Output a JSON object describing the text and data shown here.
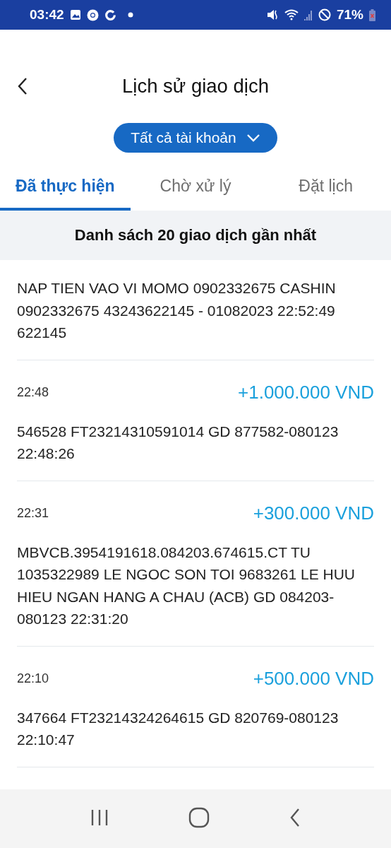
{
  "status_bar": {
    "time": "03:42",
    "battery": "71%"
  },
  "header": {
    "title": "Lịch sử giao dịch"
  },
  "account_selector": {
    "label": "Tất cả tài khoản"
  },
  "tabs": [
    {
      "label": "Đã thực hiện",
      "selected": true
    },
    {
      "label": "Chờ xử lý",
      "selected": false
    },
    {
      "label": "Đặt lịch",
      "selected": false
    }
  ],
  "list_heading": "Danh sách 20 giao dịch gần nhất",
  "transactions": [
    {
      "description": "NAP TIEN VAO VI MOMO 0902332675 CASHIN 0902332675 43243622145 - 01082023 22:52:49 622145"
    },
    {
      "time": "22:48",
      "amount": "+1.000.000 VND",
      "description": "546528 FT23214310591014 GD 877582-080123 22:48:26"
    },
    {
      "time": "22:31",
      "amount": "+300.000 VND",
      "description": "MBVCB.3954191618.084203.674615.CT TU 1035322989 LE NGOC SON TOI 9683261 LE HUU HIEU NGAN HANG A CHAU (ACB) GD 084203-080123 22:31:20"
    },
    {
      "time": "22:10",
      "amount": "+500.000 VND",
      "description": "347664 FT23214324264615 GD 820769-080123 22:10:47"
    }
  ]
}
